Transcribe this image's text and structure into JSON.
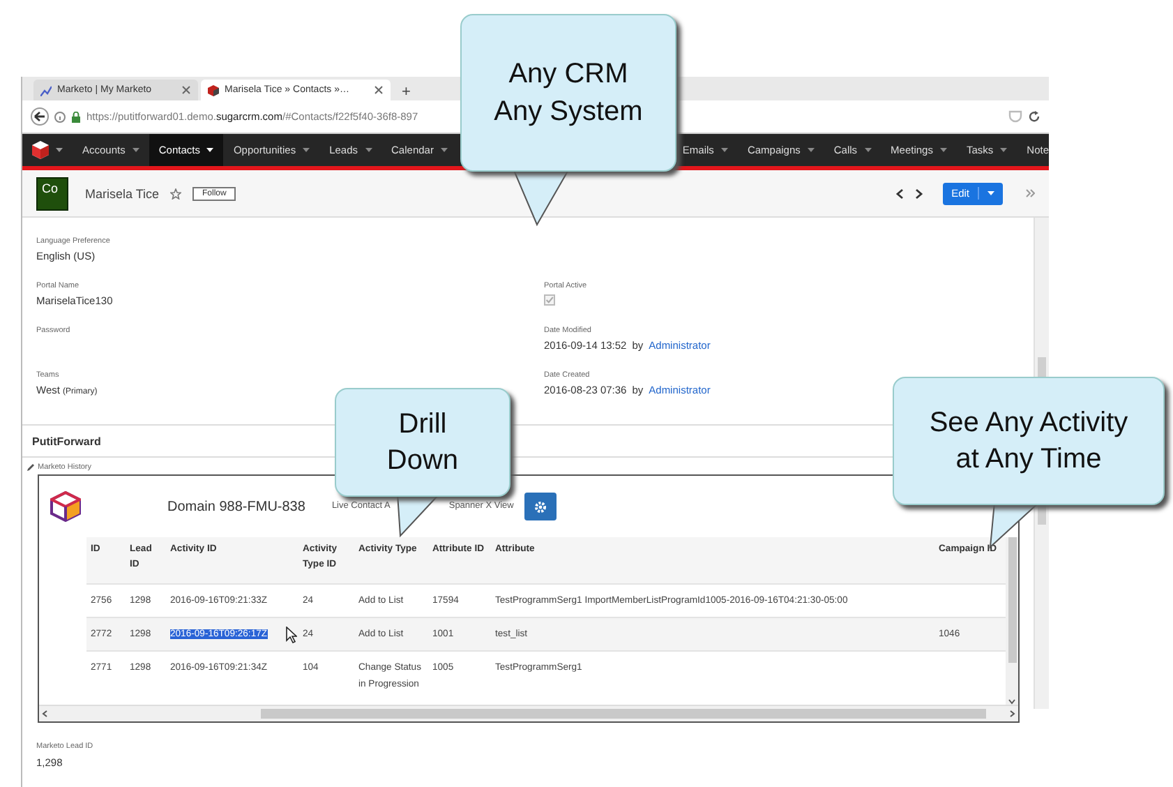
{
  "browser": {
    "tabs": [
      {
        "title": "Marketo | My Marketo",
        "selected": false
      },
      {
        "title": "Marisela Tice » Contacts »…",
        "selected": true
      }
    ],
    "new_tab": "+",
    "url": "https://putitforward01.demo.**sugarcrm.com**/#Contacts/f22f5f40-36f8-897"
  },
  "nav": {
    "items_left": [
      {
        "label": "Accounts",
        "selected": false
      },
      {
        "label": "Contacts",
        "selected": true
      },
      {
        "label": "Opportunities",
        "selected": false
      },
      {
        "label": "Leads",
        "selected": false
      },
      {
        "label": "Calendar",
        "selected": false
      }
    ],
    "items_right": [
      {
        "label": "Emails",
        "selected": false
      },
      {
        "label": "Campaigns",
        "selected": false
      },
      {
        "label": "Calls",
        "selected": false
      },
      {
        "label": "Meetings",
        "selected": false
      },
      {
        "label": "Tasks",
        "selected": false
      },
      {
        "label": "Note",
        "selected": false
      }
    ]
  },
  "record": {
    "avatar": "Co",
    "name": "Marisela Tice",
    "follow": "Follow",
    "edit": "Edit"
  },
  "fields_left": [
    {
      "kind": "text",
      "label": "Language Preference",
      "value": "English (US)"
    },
    {
      "kind": "text",
      "label": "Portal Name",
      "value": "MariselaTice130"
    },
    {
      "kind": "label",
      "label": "Password"
    },
    {
      "kind": "team",
      "label": "Teams",
      "value": "West",
      "note": "(Primary)"
    }
  ],
  "fields_right": [
    {
      "kind": "check",
      "label": "Portal Active",
      "checked": true
    },
    {
      "kind": "audit",
      "label": "Date Modified",
      "value": "2016-09-14 13:52",
      "by": "by",
      "user": "Administrator"
    },
    {
      "kind": "audit",
      "label": "Date Created",
      "value": "2016-08-23 07:36",
      "by": "by",
      "user": "Administrator"
    }
  ],
  "section": "PutitForward",
  "history_label": "Marketo History",
  "history": {
    "domain": "Domain 988-FMU-838",
    "view_left": "Live Contact A",
    "view_right": "Spanner X View",
    "columns": [
      "ID",
      "Lead ID",
      "Activity ID",
      "Activity Type ID",
      "Activity Type",
      "Attribute ID",
      "Attribute",
      "Campaign ID"
    ],
    "rows": [
      {
        "cells": [
          "2756",
          "1298",
          "2016-09-16T09:21:33Z",
          "24",
          "Add to List",
          "17594",
          "TestProgrammSerg1 ImportMemberListProgramId1005-2016-09-16T04:21:30-05:00",
          ""
        ],
        "text_selected": false
      },
      {
        "cells": [
          "2772",
          "1298",
          "2016-09-16T09:26:17Z",
          "24",
          "Add to List",
          "1001",
          "test_list",
          "1046"
        ],
        "text_selected": true
      },
      {
        "cells": [
          "2771",
          "1298",
          "2016-09-16T09:21:34Z",
          "104",
          "Change Status in Progression",
          "1005",
          "TestProgrammSerg1",
          ""
        ],
        "text_selected": false
      }
    ]
  },
  "lead_id": {
    "label": "Marketo Lead ID",
    "value": "1,298"
  },
  "callouts": [
    {
      "text": "Any CRM\nAny System"
    },
    {
      "text": "Drill\nDown"
    },
    {
      "text": "See Any Activity\nat Any Time"
    }
  ]
}
